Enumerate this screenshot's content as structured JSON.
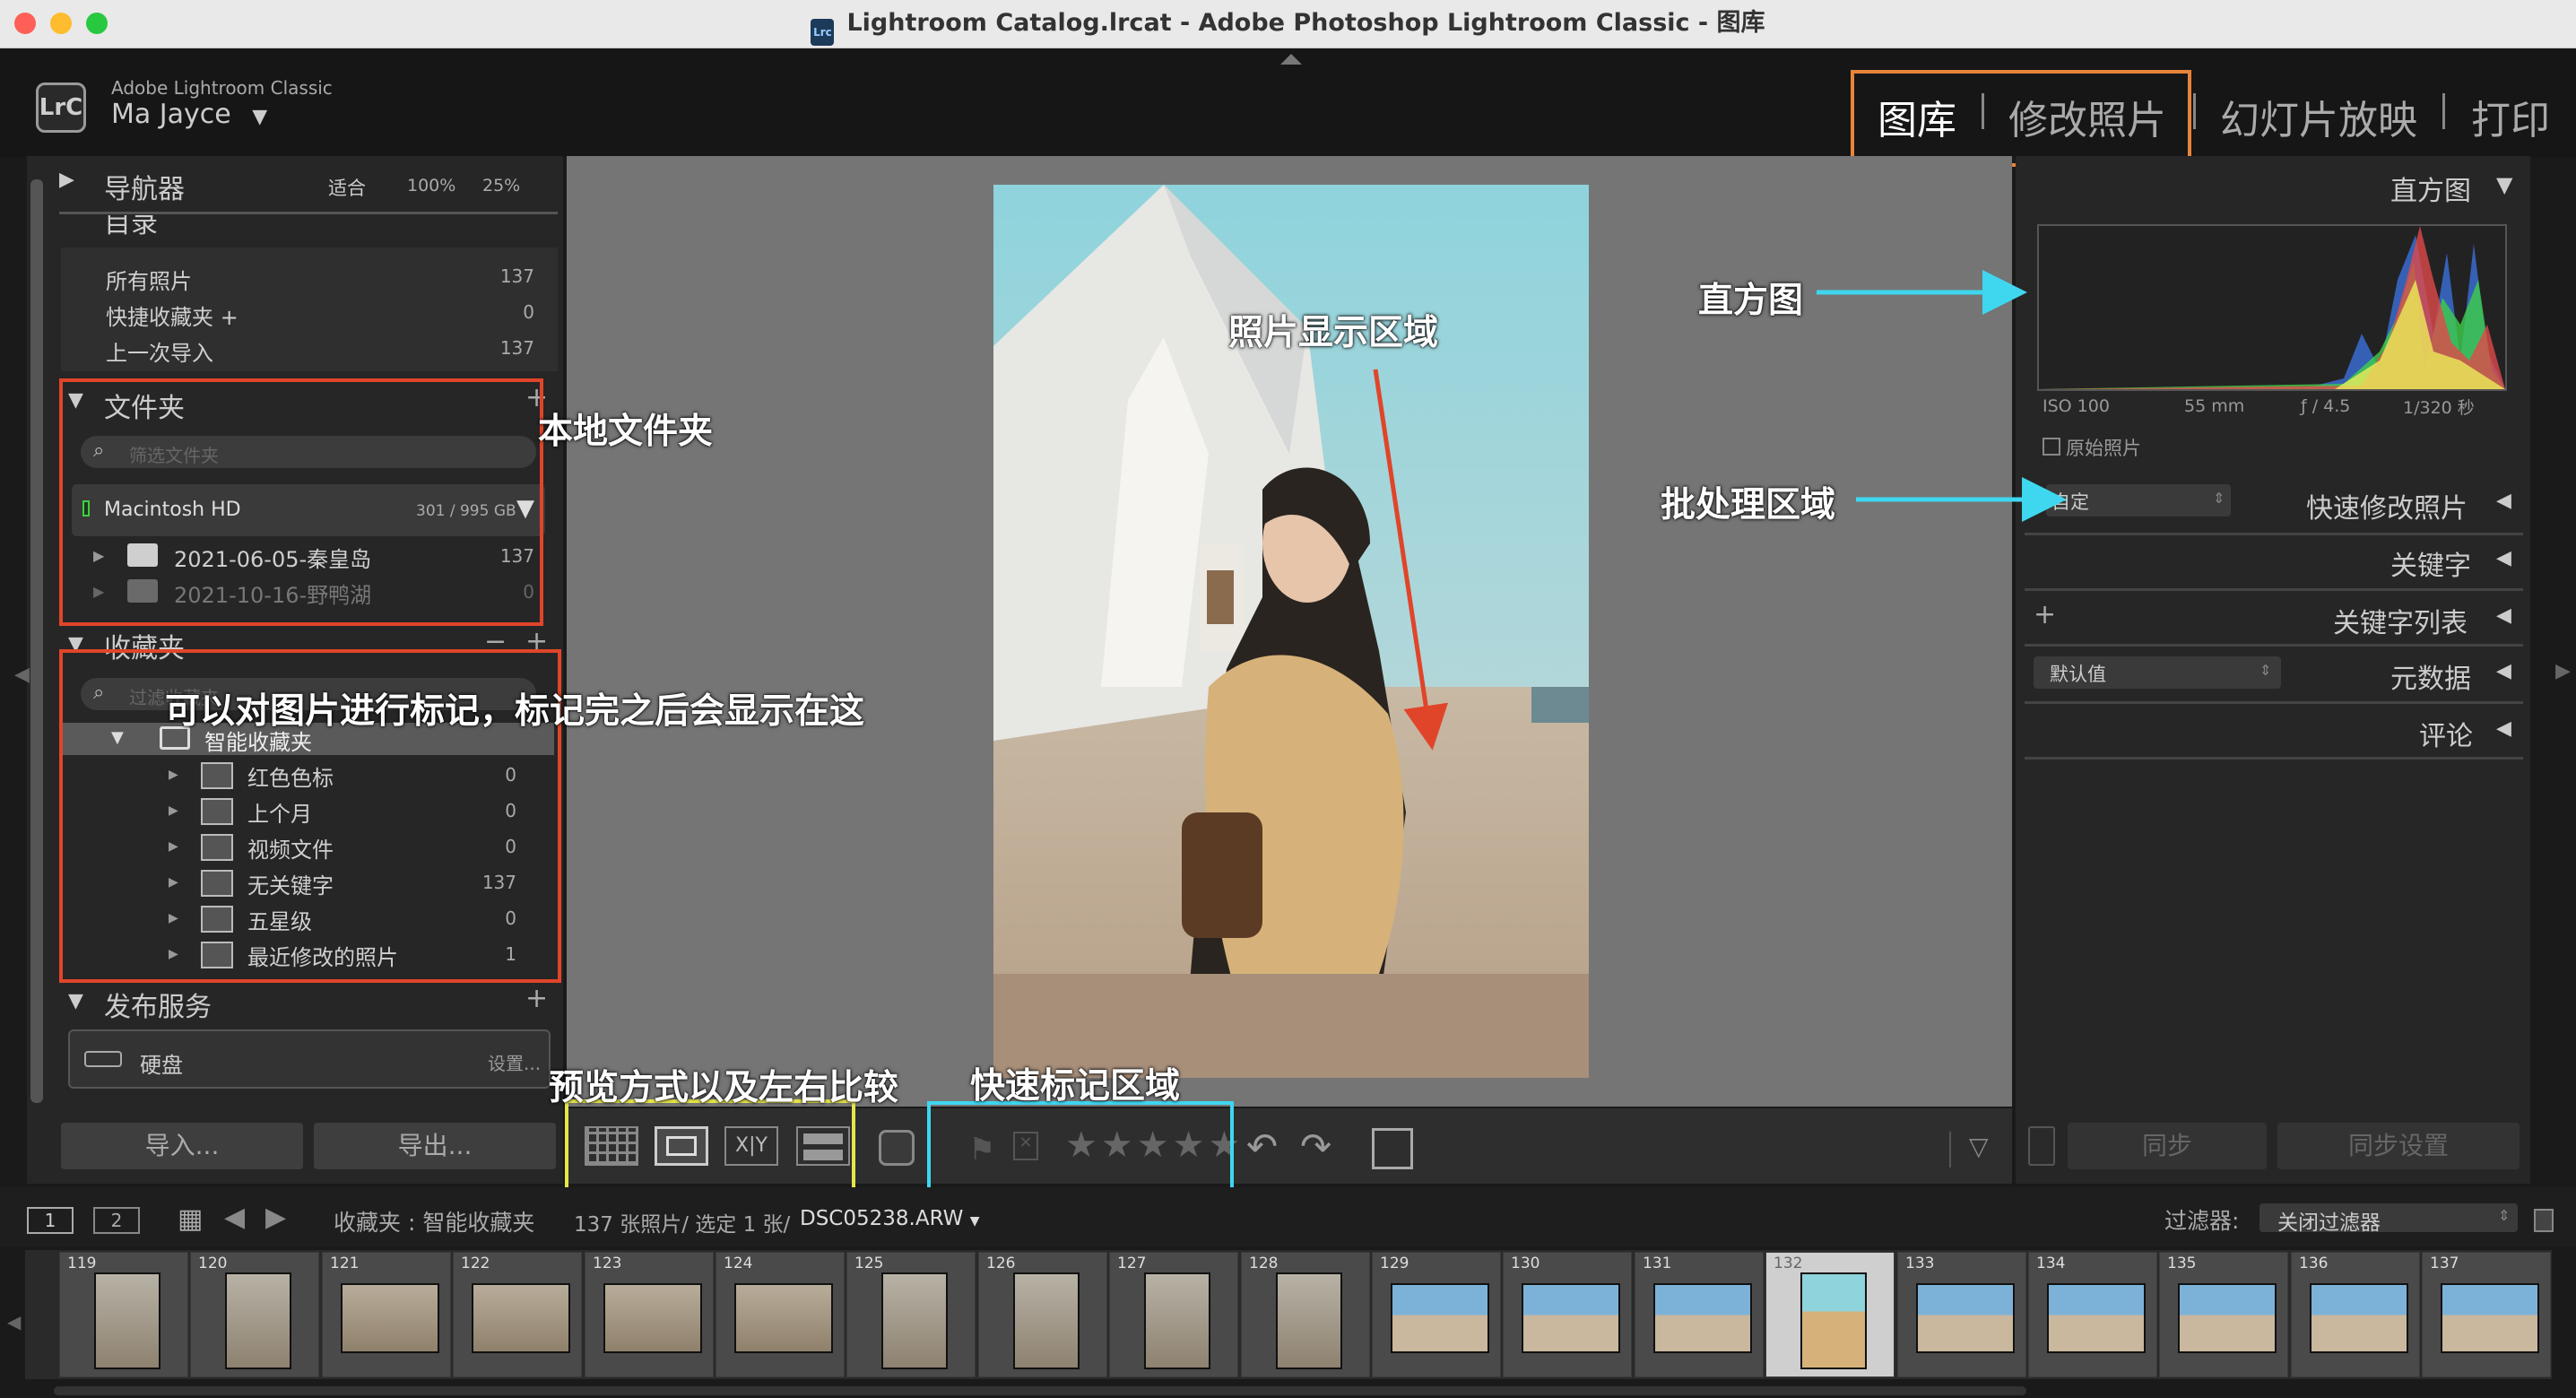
{
  "window": {
    "title": "Lightroom Catalog.lrcat - Adobe Photoshop Lightroom Classic - 图库"
  },
  "identity": {
    "app_small": "Adobe Lightroom Classic",
    "user": "Ma Jayce",
    "logo": "LrC"
  },
  "modules": [
    "图库",
    "修改照片",
    "幻灯片放映",
    "打印"
  ],
  "navigator": {
    "title": "导航器",
    "zoom1": "适合",
    "zoom2": "100%",
    "zoom3": "25%"
  },
  "catalog": {
    "title": "目录",
    "items": [
      {
        "label": "所有照片",
        "count": "137"
      },
      {
        "label": "快捷收藏夹 +",
        "count": "0"
      },
      {
        "label": "上一次导入",
        "count": "137"
      }
    ]
  },
  "folders": {
    "title": "文件夹",
    "plus": "+",
    "filter_placeholder": "筛选文件夹",
    "volume": "Macintosh HD",
    "volume_size": "301 / 995 GB",
    "items": [
      {
        "label": "2021-06-05-秦皇岛",
        "count": "137"
      },
      {
        "label": "2021-10-16-野鸭湖",
        "count": "0"
      }
    ]
  },
  "collections": {
    "title": "收藏夹",
    "minus": "−",
    "plus": "+",
    "filter_placeholder": "过滤收藏夹",
    "smart_set": "智能收藏夹",
    "items": [
      {
        "label": "红色色标",
        "count": "0"
      },
      {
        "label": "上个月",
        "count": "0"
      },
      {
        "label": "视频文件",
        "count": "0"
      },
      {
        "label": "无关键字",
        "count": "137"
      },
      {
        "label": "五星级",
        "count": "0"
      },
      {
        "label": "最近修改的照片",
        "count": "1"
      }
    ]
  },
  "publish": {
    "title": "发布服务",
    "plus": "+",
    "disk": "硬盘",
    "disk_action": "设置..."
  },
  "bottom_left": {
    "import": "导入...",
    "export": "导出..."
  },
  "right": {
    "histogram": "直方图",
    "iso": "ISO 100",
    "focal": "55 mm",
    "aperture": "ƒ / 4.5",
    "shutter": "1/320 秒",
    "original": "原始照片",
    "preset": "自定",
    "quick_develop": "快速修改照片",
    "keywording": "关键字",
    "keyword_list": "关键字列表",
    "plus": "+",
    "metadata_preset": "默认值",
    "metadata": "元数据",
    "comments": "评论",
    "sync": "同步",
    "sync_settings": "同步设置"
  },
  "annotations": {
    "folder": "本地文件夹",
    "collection": "可以对图片进行标记，标记完之后会显示在这",
    "photo": "照片显示区域",
    "histogram": "直方图",
    "batch": "批处理区域",
    "preview": "预览方式以及左右比较",
    "flag": "快速标记区域"
  },
  "toolbar": {
    "stars": "★★★★★",
    "dropdown": "▽"
  },
  "filmstrip_bar": {
    "screen1": "1",
    "screen2": "2",
    "source": "收藏夹 : 智能收藏夹",
    "count_info": "137 张照片/ 选定 1 张/",
    "filename": "DSC05238.ARW",
    "filter_label": "过滤器:",
    "filter_value": "关闭过滤器"
  },
  "filmstrip": {
    "numbers": [
      "119",
      "120",
      "121",
      "122",
      "123",
      "124",
      "125",
      "126",
      "127",
      "128",
      "129",
      "130",
      "131",
      "132",
      "133",
      "134",
      "135",
      "136",
      "137"
    ]
  },
  "colors": {
    "accent_orange": "#e8843a",
    "annot_red": "#e0452a",
    "annot_cyan": "#3fd6f0",
    "annot_yellow": "#e6e64a"
  }
}
